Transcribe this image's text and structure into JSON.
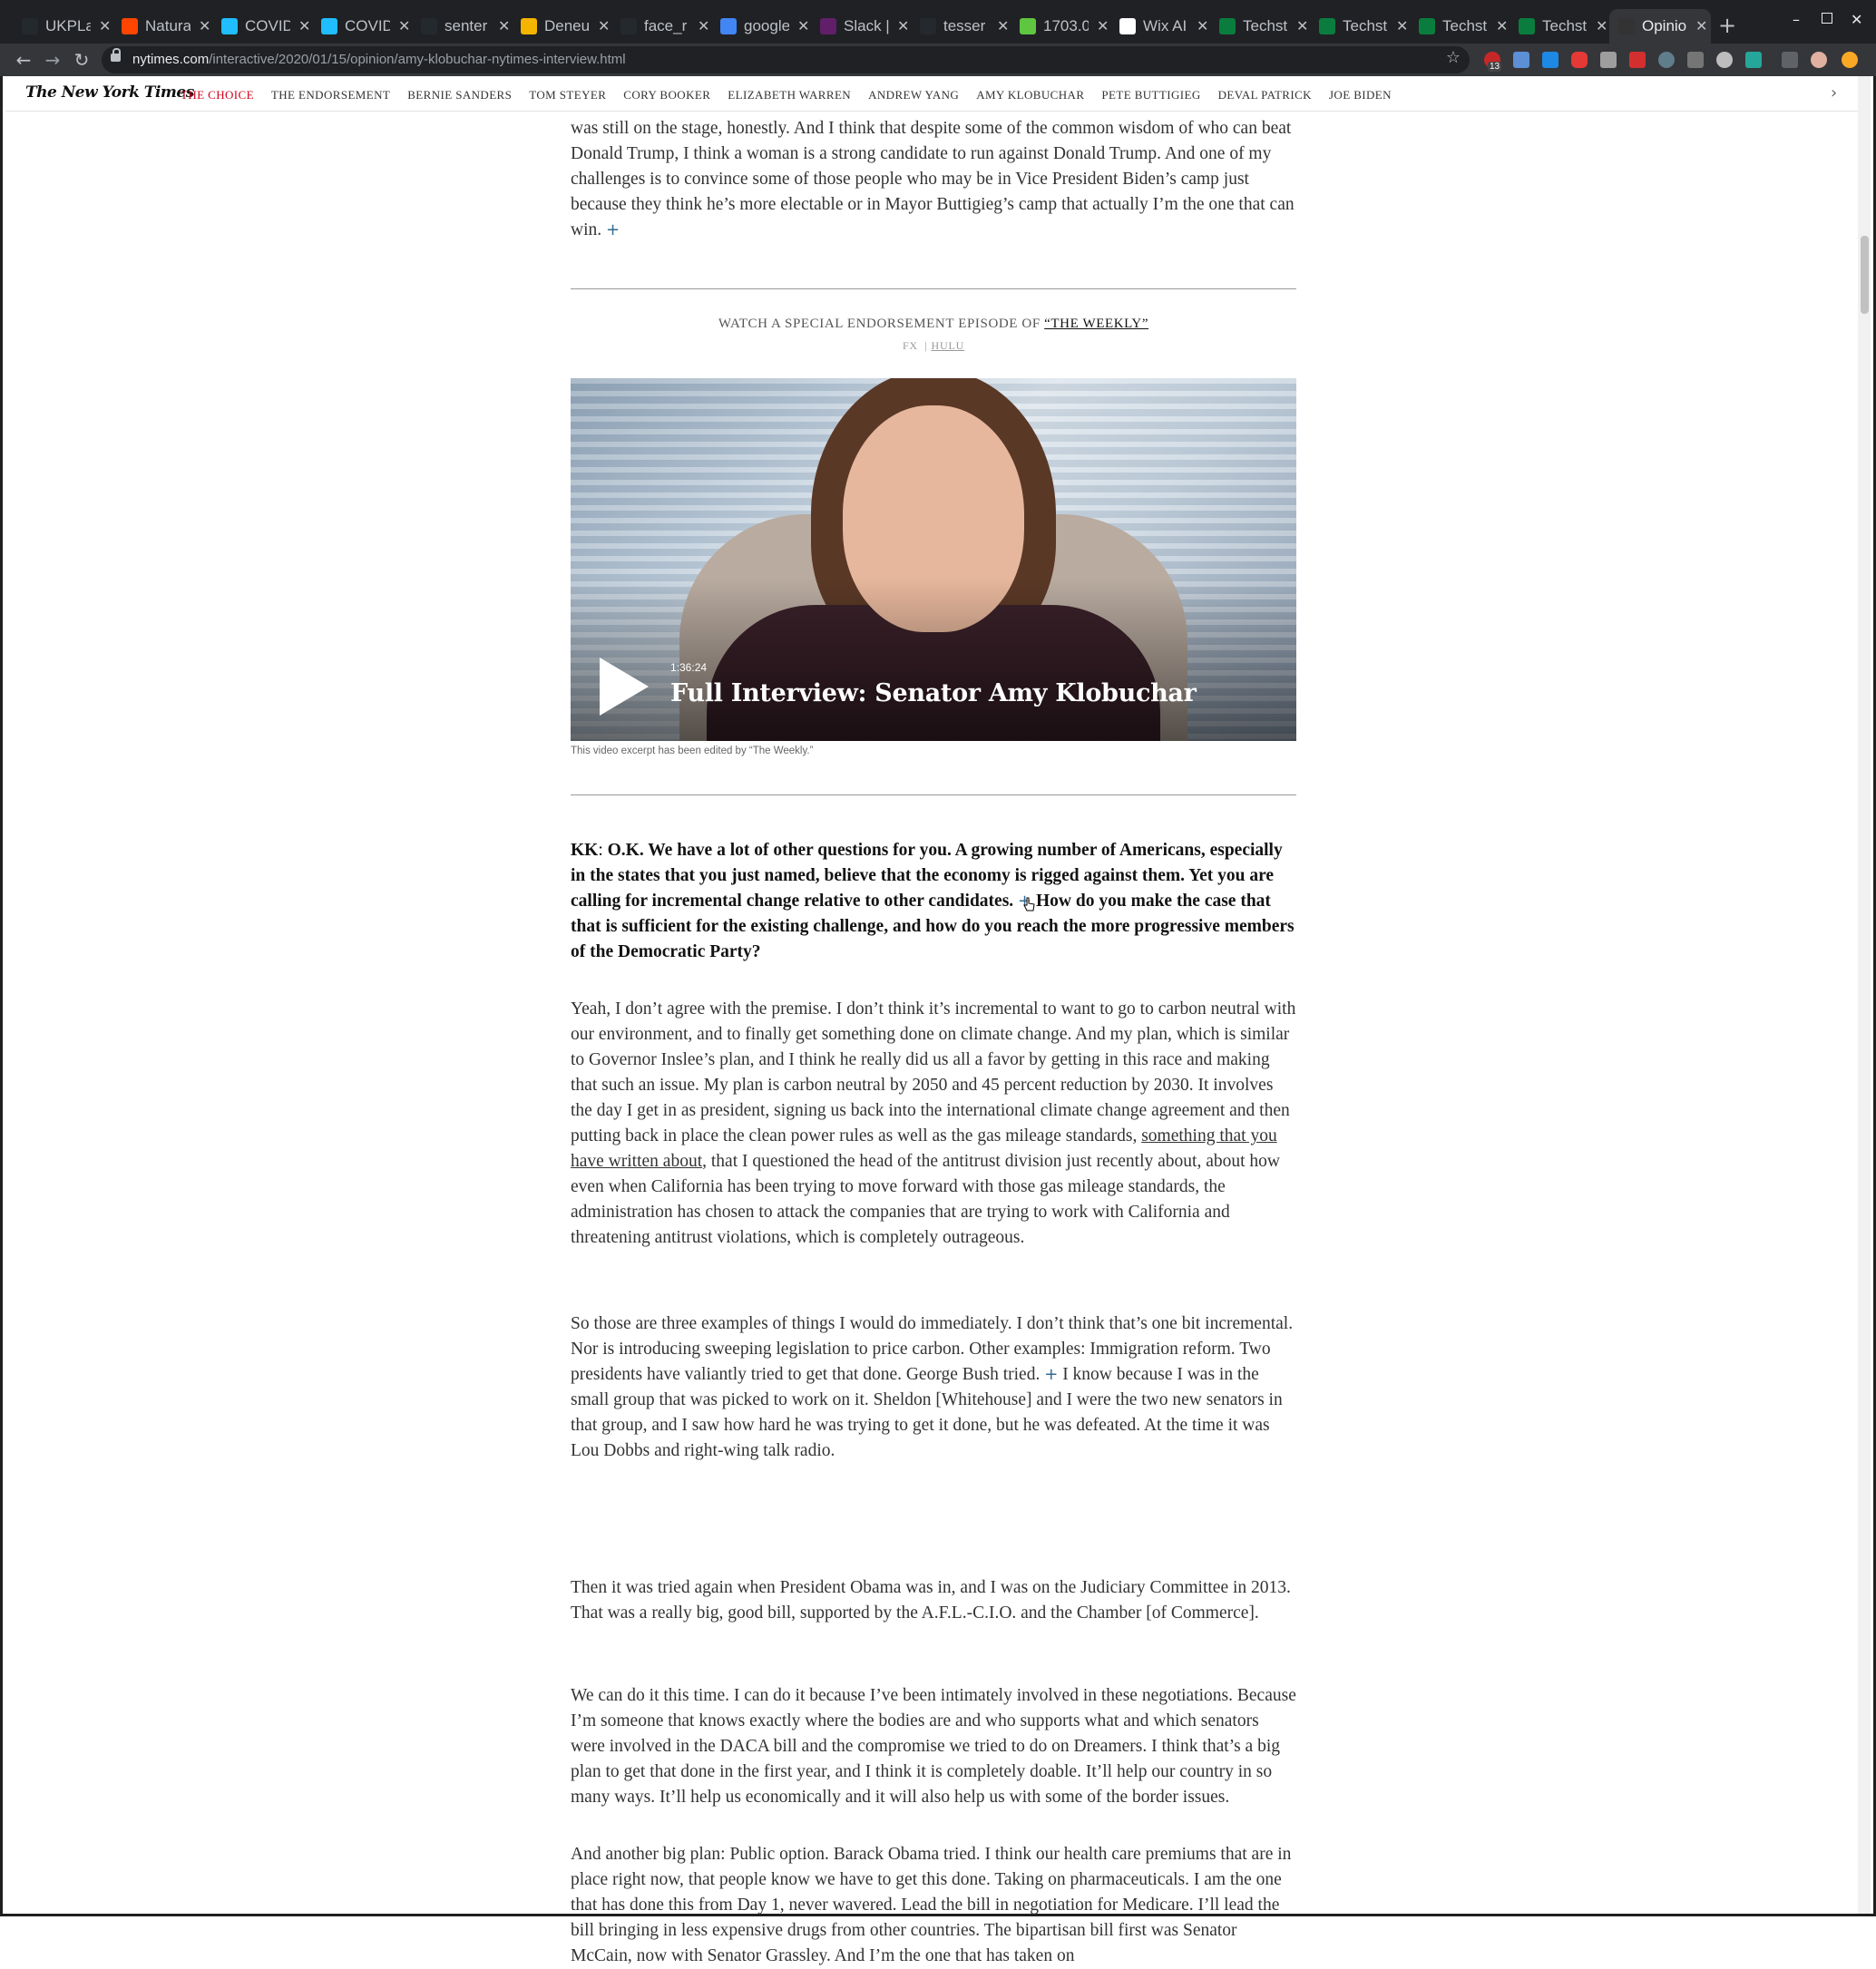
{
  "browser": {
    "tabs": [
      {
        "title": "UKPLa",
        "icon": "github-icon",
        "color": "#24292e"
      },
      {
        "title": "Natura",
        "icon": "reddit-icon",
        "color": "#ff4500"
      },
      {
        "title": "COVID",
        "icon": "kaggle-icon",
        "color": "#20beff"
      },
      {
        "title": "COVID",
        "icon": "kaggle-icon",
        "color": "#20beff"
      },
      {
        "title": "senter",
        "icon": "github-icon",
        "color": "#24292e"
      },
      {
        "title": "Deneu",
        "icon": "slides-icon",
        "color": "#f4b400"
      },
      {
        "title": "face_r",
        "icon": "github-icon",
        "color": "#24292e"
      },
      {
        "title": "google",
        "icon": "google-icon",
        "color": "#4285f4"
      },
      {
        "title": "Slack |",
        "icon": "slack-icon",
        "color": "#611f69"
      },
      {
        "title": "tesser",
        "icon": "github-icon",
        "color": "#24292e"
      },
      {
        "title": "1703.0",
        "icon": "arxiv-icon",
        "color": "#5ec641"
      },
      {
        "title": "Wix AI",
        "icon": "wix-icon",
        "color": "#ffffff"
      },
      {
        "title": "Techst",
        "icon": "techstars-icon",
        "color": "#0a7d3e"
      },
      {
        "title": "Techst",
        "icon": "techstars-icon",
        "color": "#0a7d3e"
      },
      {
        "title": "Techst",
        "icon": "techstars-icon",
        "color": "#0a7d3e"
      },
      {
        "title": "Techst",
        "icon": "techstars-icon",
        "color": "#0a7d3e"
      },
      {
        "title": "Opinio",
        "icon": "nytimes-icon",
        "color": "#333333",
        "active": true
      }
    ],
    "url_host": "nytimes.com",
    "url_path": "/interactive/2020/01/15/opinion/amy-klobuchar-nytimes-interview.html",
    "extension_badge": "13"
  },
  "nyt": {
    "logo": "The New York Times",
    "nav": [
      "THE CHOICE",
      "THE ENDORSEMENT",
      "BERNIE SANDERS",
      "TOM STEYER",
      "CORY BOOKER",
      "ELIZABETH WARREN",
      "ANDREW YANG",
      "AMY KLOBUCHAR",
      "PETE BUTTIGIEG",
      "DEVAL PATRICK",
      "JOE BIDEN"
    ]
  },
  "article": {
    "intro_para": "was still on the stage, honestly. And I think that despite some of the common wisdom of who can beat Donald Trump, I think a woman is a strong candidate to run against Donald Trump. And one of my challenges is to convince some of those people who may be in Vice President Biden’s camp just because they think he’s more electable or in Mayor Buttigieg’s camp that actually I’m the one that can win.",
    "watch_prefix": "WATCH A SPECIAL ENDORSEMENT EPISODE OF ",
    "watch_link": "“THE WEEKLY”",
    "platform_fx": "FX",
    "platform_sep": "|",
    "platform_hulu": "HULU",
    "video_duration": "1:36:24",
    "video_title": "Full Interview: Senator Amy Klobuchar",
    "video_caption": "This video excerpt has been edited by “The Weekly.”",
    "q_speaker": "KK",
    "q_colon": ":",
    "q_part1": "O.K. We have a lot of other questions for you. A growing number of Americans, especially in the states that you just named, believe that the economy is rigged against them. Yet you are calling for incremental change relative to other candidates.",
    "q_part2": "How do you make the case that that is sufficient for the existing challenge, and how do you reach the more progressive members of the Democratic Party?",
    "p1_a": "Yeah, I don’t agree with the premise. I don’t think it’s incremental to want to go to carbon neutral with our environment, and to finally get something done on climate change. And my plan, which is similar to Governor Inslee’s plan, and I think he really did us all a favor by getting in this race and making that such an issue. My plan is carbon neutral by 2050 and 45 percent reduction by 2030. It involves the day I get in as president, signing us back into the international climate change agreement and then putting back in place the clean power rules as well as the gas mileage standards, ",
    "p1_link": "something that you have written about",
    "p1_b": ", that I questioned the head of the antitrust division just recently about, about how even when California has been trying to move forward with those gas mileage standards, the administration has chosen to attack the companies that are trying to work with California and threatening antitrust violations, which is completely outrageous.",
    "p2_a": "So those are three examples of things I would do immediately. I don’t think that’s one bit incremental. Nor is introducing sweeping legislation to price carbon. Other examples: Immigration reform. Two presidents have valiantly tried to get that done. George Bush tried.",
    "p2_b": "I know because I was in the small group that was picked to work on it. Sheldon [Whitehouse] and I were the two new senators in that group, and I saw how hard he was trying to get it done, but he was defeated. At the time it was Lou Dobbs and right-wing talk radio.",
    "p3": "Then it was tried again when President Obama was in, and I was on the Judiciary Committee in 2013. That was a really big, good bill, supported by the A.F.L.-C.I.O. and the Chamber [of Commerce].",
    "p4": "We can do it this time. I can do it because I’ve been intimately involved in these negotiations. Because I’m someone that knows exactly where the bodies are and who supports what and which senators were involved in the DACA bill and the compromise we tried to do on Dreamers. I think that’s a big plan to get that done in the first year, and I think it is completely doable. It’ll help our country in so many ways. It’ll help us economically and it will also help us with some of the border issues.",
    "p5": "And another big plan: Public option. Barack Obama tried. I think our health care premiums that are in place right now, that people know we have to get this done. Taking on pharmaceuticals. I am the one that has done this from Day 1, never wavered. Lead the bill in negotiation for Medicare. I’ll lead the bill bringing in less expensive drugs from other countries. The bipartisan bill first was Senator McCain, now with Senator Grassley. And I’m the one that has taken on",
    "plus_glyph": "+"
  }
}
